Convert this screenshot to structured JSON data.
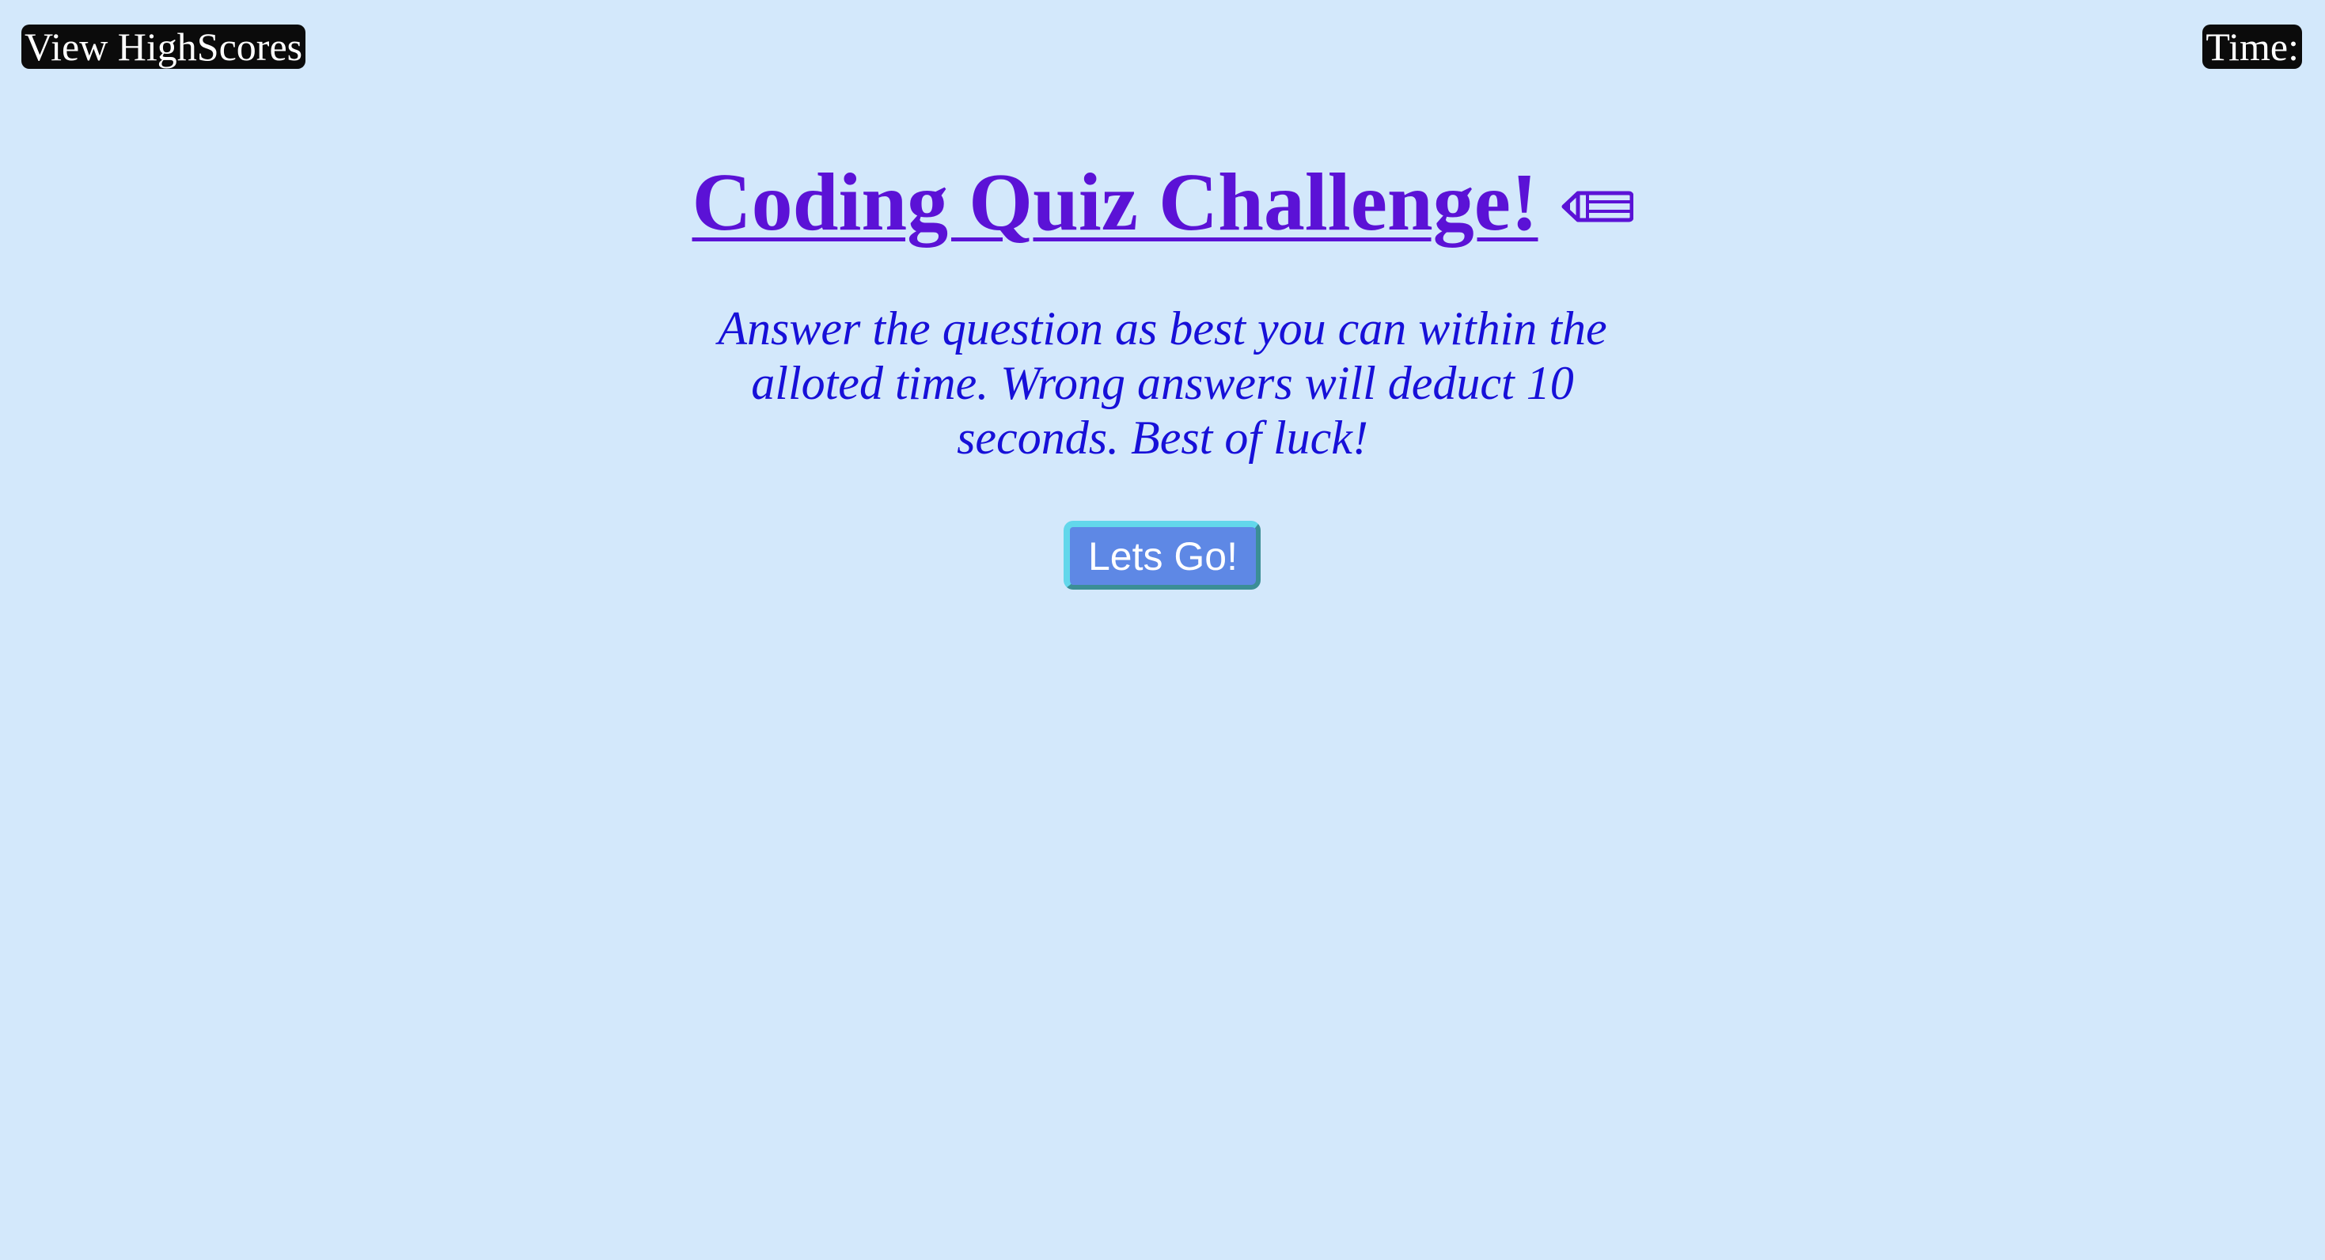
{
  "header": {
    "highscores_label": "View HighScores",
    "timer_label": "Time:"
  },
  "intro": {
    "title": "Coding Quiz Challenge!",
    "title_icon": "pencil-icon",
    "instructions": "Answer the question as best you can within the alloted time. Wrong answers will deduct 10 seconds. Best of luck!",
    "start_label": "Lets Go!"
  },
  "colors": {
    "background": "#d3e8fb",
    "title": "#5b12d6",
    "instructions": "#1710d8",
    "badge_bg": "#0b0b0b",
    "button_bg": "#5e88e5",
    "button_border_light": "#62d7eb",
    "button_border_dark": "#3b8e96"
  }
}
